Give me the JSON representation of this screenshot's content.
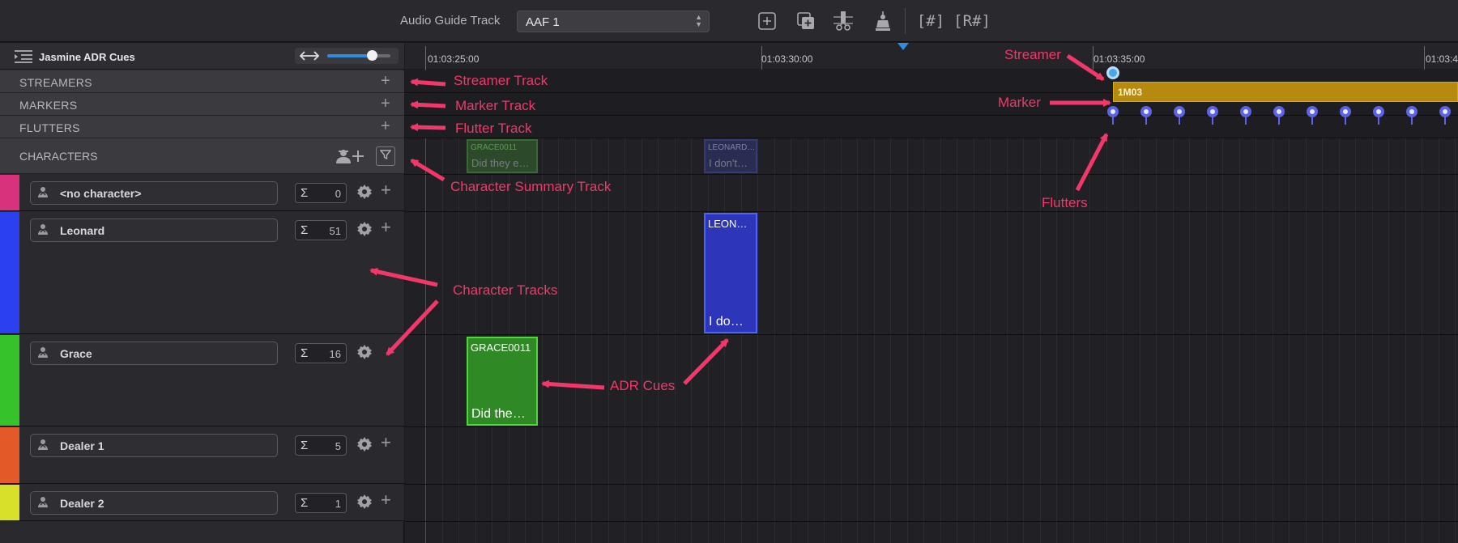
{
  "toolbar": {
    "guide_label": "Audio Guide Track",
    "guide_value": "AAF 1",
    "icons": [
      "add-square-icon",
      "duplicate-icon",
      "razor-icon",
      "stamp-icon",
      "bracket-hash-icon",
      "bracket-r-hash-icon"
    ],
    "bracket_hash": "[#]",
    "bracket_r_hash": "[R#]"
  },
  "project": {
    "title": "Jasmine ADR Cues"
  },
  "zoom": {
    "level": 0.7
  },
  "system_tracks": [
    {
      "label": "STREAMERS"
    },
    {
      "label": "MARKERS"
    },
    {
      "label": "FLUTTERS"
    }
  ],
  "characters_header": "CHARACTERS",
  "characters": [
    {
      "name": "<no character>",
      "count": "0",
      "color": "#d8327c",
      "has_plus": true
    },
    {
      "name": "Leonard",
      "count": "51",
      "color": "#2b41f0",
      "has_plus": true
    },
    {
      "name": "Grace",
      "count": "16",
      "color": "#36c22a",
      "has_plus": false
    },
    {
      "name": "Dealer 1",
      "count": "5",
      "color": "#e35a28",
      "has_plus": true
    },
    {
      "name": "Dealer 2",
      "count": "1",
      "color": "#d9e02a",
      "has_plus": true
    }
  ],
  "ruler": {
    "timecodes": [
      "01:03:25:00",
      "01:03:30:00",
      "01:03:35:00",
      "01:03:4"
    ]
  },
  "cues": {
    "grace": {
      "id": "GRACE0011",
      "text": "Did the…"
    },
    "leonard": {
      "id": "LEON…",
      "text": "I do…"
    },
    "summary_grace": {
      "id": "GRACE0011",
      "text": "Did they e…"
    },
    "summary_leonard": {
      "id": "LEONARD…",
      "text": "I don't…"
    }
  },
  "marker": {
    "label": "1M03"
  },
  "colors": {
    "accent": "#2f8cdf",
    "annotation": "#f13869",
    "marker": "#b58a0f",
    "flutter": "#5b63e8"
  },
  "annotations": {
    "streamer_track": "Streamer Track",
    "marker_track": "Marker Track",
    "flutter_track": "Flutter Track",
    "character_summary": "Character Summary Track",
    "character_tracks": "Character Tracks",
    "adr_cues": "ADR Cues",
    "streamer": "Streamer",
    "marker": "Marker",
    "flutters": "Flutters"
  }
}
